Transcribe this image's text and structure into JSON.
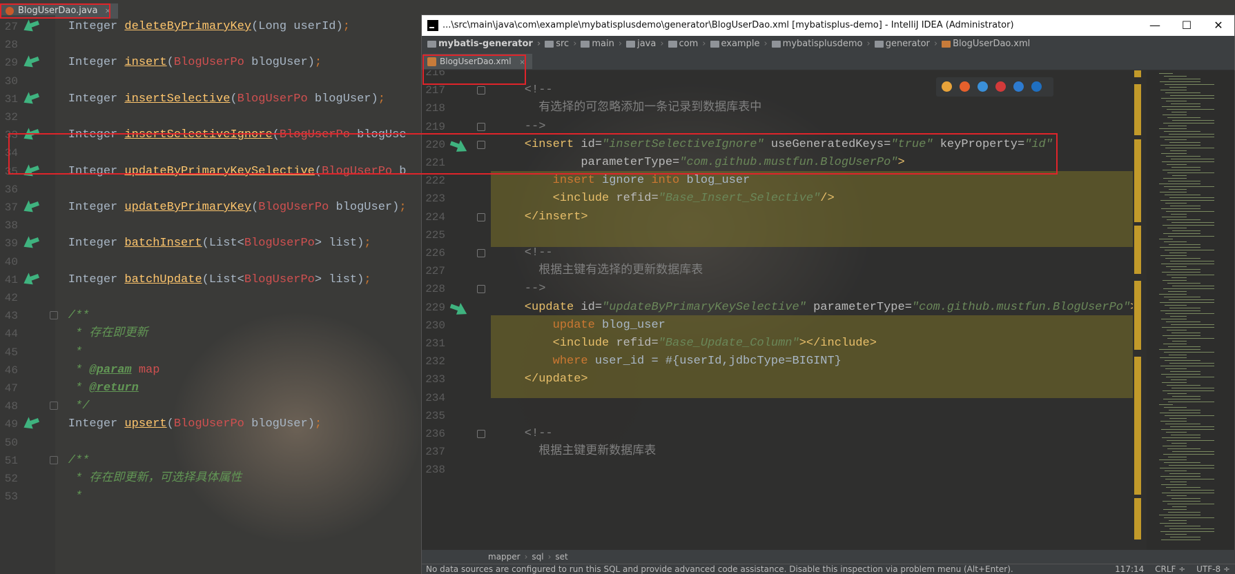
{
  "left_editor": {
    "tab_label": "BlogUserDao.java",
    "tab_close": "×",
    "lines": [
      {
        "n": "27",
        "parts": [
          [
            "ty",
            "    Integer "
          ],
          [
            "meth",
            "deleteByPrimaryKey"
          ],
          [
            "ty",
            "(Long userId)"
          ],
          [
            "kw",
            ";"
          ]
        ]
      },
      {
        "n": "28",
        "parts": []
      },
      {
        "n": "29",
        "parts": [
          [
            "ty",
            "    Integer "
          ],
          [
            "meth",
            "insert"
          ],
          [
            "ty",
            "("
          ],
          [
            "red",
            "BlogUserPo"
          ],
          [
            "ty",
            " blogUser)"
          ],
          [
            "kw",
            ";"
          ]
        ]
      },
      {
        "n": "30",
        "parts": []
      },
      {
        "n": "31",
        "parts": [
          [
            "ty",
            "    Integer "
          ],
          [
            "meth",
            "insertSelective"
          ],
          [
            "ty",
            "("
          ],
          [
            "red",
            "BlogUserPo"
          ],
          [
            "ty",
            " blogUser)"
          ],
          [
            "kw",
            ";"
          ]
        ]
      },
      {
        "n": "32",
        "parts": []
      },
      {
        "n": "33",
        "parts": [
          [
            "ty",
            "    Integer "
          ],
          [
            "meth",
            "insertSelectiveIgnore"
          ],
          [
            "ty",
            "("
          ],
          [
            "red",
            "BlogUserPo"
          ],
          [
            "ty",
            " blogUse"
          ]
        ]
      },
      {
        "n": "34",
        "parts": []
      },
      {
        "n": "35",
        "parts": [
          [
            "ty",
            "    Integer "
          ],
          [
            "meth",
            "updateByPrimaryKeySelective"
          ],
          [
            "ty",
            "("
          ],
          [
            "red",
            "BlogUserPo"
          ],
          [
            "ty",
            " b"
          ]
        ]
      },
      {
        "n": "36",
        "parts": []
      },
      {
        "n": "37",
        "parts": [
          [
            "ty",
            "    Integer "
          ],
          [
            "meth",
            "updateByPrimaryKey"
          ],
          [
            "ty",
            "("
          ],
          [
            "red",
            "BlogUserPo"
          ],
          [
            "ty",
            " blogUser)"
          ],
          [
            "kw",
            ";"
          ]
        ]
      },
      {
        "n": "38",
        "parts": []
      },
      {
        "n": "39",
        "parts": [
          [
            "ty",
            "    Integer "
          ],
          [
            "meth",
            "batchInsert"
          ],
          [
            "ty",
            "(List<"
          ],
          [
            "red",
            "BlogUserPo"
          ],
          [
            "ty",
            "> list)"
          ],
          [
            "kw",
            ";"
          ]
        ]
      },
      {
        "n": "40",
        "parts": []
      },
      {
        "n": "41",
        "parts": [
          [
            "ty",
            "    Integer "
          ],
          [
            "meth",
            "batchUpdate"
          ],
          [
            "ty",
            "(List<"
          ],
          [
            "red",
            "BlogUserPo"
          ],
          [
            "ty",
            "> list)"
          ],
          [
            "kw",
            ";"
          ]
        ]
      },
      {
        "n": "42",
        "parts": []
      },
      {
        "n": "43",
        "parts": [
          [
            "com",
            "    /**"
          ]
        ]
      },
      {
        "n": "44",
        "parts": [
          [
            "com",
            "     * 存在即更新"
          ]
        ]
      },
      {
        "n": "45",
        "parts": [
          [
            "com",
            "     *"
          ]
        ]
      },
      {
        "n": "46",
        "parts": [
          [
            "com",
            "     * "
          ],
          [
            "docbold",
            "@param"
          ],
          [
            "red",
            " map"
          ]
        ]
      },
      {
        "n": "47",
        "parts": [
          [
            "com",
            "     * "
          ],
          [
            "docbold",
            "@return"
          ]
        ]
      },
      {
        "n": "48",
        "parts": [
          [
            "com",
            "     */"
          ]
        ]
      },
      {
        "n": "49",
        "parts": [
          [
            "ty",
            "    Integer "
          ],
          [
            "meth",
            "upsert"
          ],
          [
            "ty",
            "("
          ],
          [
            "red",
            "BlogUserPo"
          ],
          [
            "ty",
            " blogUser)"
          ],
          [
            "kw",
            ";"
          ]
        ]
      },
      {
        "n": "50",
        "parts": []
      },
      {
        "n": "51",
        "parts": [
          [
            "com",
            "    /**"
          ]
        ]
      },
      {
        "n": "52",
        "parts": [
          [
            "com",
            "     * 存在即更新，可选择具体属性"
          ]
        ]
      },
      {
        "n": "53",
        "parts": [
          [
            "com",
            "     *"
          ]
        ]
      }
    ]
  },
  "window": {
    "title": "...\\src\\main\\java\\com\\example\\mybatisplusdemo\\generator\\BlogUserDao.xml [mybatisplus-demo] - IntelliJ IDEA (Administrator)",
    "minimize": "—",
    "maximize": "☐",
    "close": "✕"
  },
  "navbar": {
    "crumbs": [
      "mybatis-generator",
      "src",
      "main",
      "java",
      "com",
      "example",
      "mybatisplusdemo",
      "generator",
      "BlogUserDao.xml"
    ]
  },
  "xml_tab": {
    "label": "BlogUserDao.xml",
    "close": "×"
  },
  "right_editor": {
    "lines": [
      {
        "n": "216",
        "parts": []
      },
      {
        "n": "217",
        "parts": [
          [
            "xcom",
            "    <!--"
          ]
        ]
      },
      {
        "n": "218",
        "parts": [
          [
            "xcom",
            "      有选择的可忽略添加一条记录到数据库表中"
          ]
        ]
      },
      {
        "n": "219",
        "parts": [
          [
            "xcom",
            "    -->"
          ]
        ]
      },
      {
        "n": "220",
        "parts": [
          [
            "tag",
            "    <insert "
          ],
          [
            "attr",
            "id="
          ],
          [
            "str",
            "\"insertSelectiveIgnore\""
          ],
          [
            "attr",
            " useGeneratedKeys="
          ],
          [
            "str",
            "\"true\""
          ],
          [
            "attr",
            " keyProperty="
          ],
          [
            "str",
            "\"id\""
          ]
        ]
      },
      {
        "n": "221",
        "parts": [
          [
            "attr",
            "            parameterType="
          ],
          [
            "str",
            "\"com.github.mustfun.BlogUserPo\""
          ],
          [
            "tag",
            ">"
          ]
        ]
      },
      {
        "n": "222",
        "parts": [
          [
            "kw",
            "        insert"
          ],
          [
            "ty",
            " ignore "
          ],
          [
            "kw",
            "into"
          ],
          [
            "ty",
            " blog_user"
          ]
        ]
      },
      {
        "n": "223",
        "parts": [
          [
            "tag",
            "        <include "
          ],
          [
            "attr",
            "refid="
          ],
          [
            "str",
            "\"Base_Insert_Selective\""
          ],
          [
            "tag",
            "/>"
          ]
        ]
      },
      {
        "n": "224",
        "parts": [
          [
            "tag",
            "    </insert>"
          ]
        ]
      },
      {
        "n": "225",
        "parts": []
      },
      {
        "n": "226",
        "parts": [
          [
            "xcom",
            "    <!--"
          ]
        ]
      },
      {
        "n": "227",
        "parts": [
          [
            "xcom",
            "      根据主键有选择的更新数据库表"
          ]
        ]
      },
      {
        "n": "228",
        "parts": [
          [
            "xcom",
            "    -->"
          ]
        ]
      },
      {
        "n": "229",
        "parts": [
          [
            "tag",
            "    <update "
          ],
          [
            "attr",
            "id="
          ],
          [
            "str",
            "\"updateByPrimaryKeySelective\""
          ],
          [
            "attr",
            " parameterType="
          ],
          [
            "str",
            "\"com.github.mustfun.BlogUserPo\""
          ],
          [
            "tag",
            ">"
          ]
        ]
      },
      {
        "n": "230",
        "parts": [
          [
            "kw",
            "        update"
          ],
          [
            "ty",
            " blog_user"
          ]
        ]
      },
      {
        "n": "231",
        "parts": [
          [
            "tag",
            "        <include "
          ],
          [
            "attr",
            "refid="
          ],
          [
            "str",
            "\"Base_Update_Column\""
          ],
          [
            "tag",
            "></include>"
          ]
        ]
      },
      {
        "n": "232",
        "parts": [
          [
            "kw",
            "        where"
          ],
          [
            "ty",
            " user_id = #{userId,jdbcType=BIGINT}"
          ]
        ]
      },
      {
        "n": "233",
        "parts": [
          [
            "tag",
            "    </update>"
          ]
        ]
      },
      {
        "n": "234",
        "parts": []
      },
      {
        "n": "235",
        "parts": []
      },
      {
        "n": "236",
        "parts": [
          [
            "xcom",
            "    <!--"
          ]
        ]
      },
      {
        "n": "237",
        "parts": [
          [
            "xcom",
            "      根据主键更新数据库表"
          ]
        ]
      },
      {
        "n": "238",
        "parts": []
      }
    ]
  },
  "breadcrumbs": [
    "mapper",
    "sql",
    "set"
  ],
  "status": {
    "message": "No data sources are configured to run this SQL and provide advanced code assistance. Disable this inspection via problem menu (Alt+Enter).",
    "position": "117:14",
    "line_sep": "CRLF ÷",
    "encoding": "UTF-8 ÷"
  },
  "colors": {
    "annotation": "#e0242a",
    "gutter_arrow": "#3fb37f"
  }
}
